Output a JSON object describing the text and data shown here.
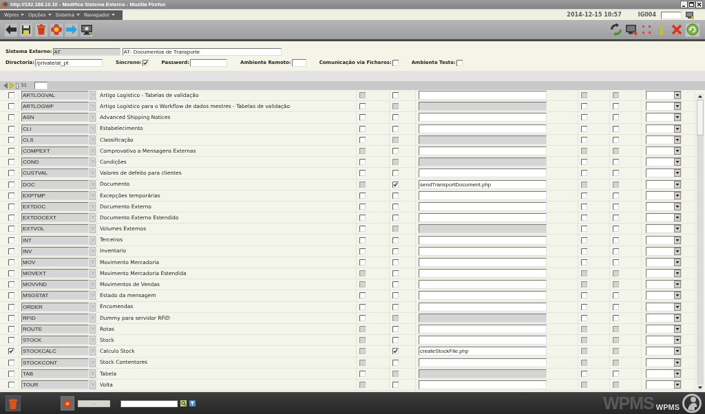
{
  "window": {
    "title": "http://192.168.10.10 - Modifica Sistema Externo - Mozilla Firefox"
  },
  "menu": [
    {
      "label": "Wpms"
    },
    {
      "label": "Opções"
    },
    {
      "label": "Sistema"
    },
    {
      "label": "Navegador"
    }
  ],
  "session": {
    "datetime": "2014-12-15 10:57",
    "user": "IG004"
  },
  "form": {
    "system": {
      "label": "Sistema Externo:",
      "code": {
        "value": "AT",
        "disabled": true
      },
      "name": {
        "value": "AT- Documentos de Transporte",
        "disabled": false
      }
    },
    "directory": {
      "label": "Directoria:",
      "value": "/private/at_pt"
    },
    "synchronous": {
      "label": "Síncrono:",
      "checked": true
    },
    "password": {
      "label": "Password:"
    },
    "remote_environment": {
      "label": "Ambiente Remoto:"
    },
    "file_communication": {
      "label": "Comunicação via Ficheros:",
      "checked": false
    },
    "test_environment": {
      "label": "Ambiente Teste:",
      "checked": false
    }
  },
  "pager": {
    "count": "31"
  },
  "rows": [
    {
      "checked": false,
      "code": "ARTLOGVAL",
      "lookup": "?",
      "description": "Artigo Logistico - Tabelas de validação",
      "flags_left": [
        {
          "checked": false,
          "disabled": true
        },
        {
          "checked": false,
          "disabled": false
        }
      ],
      "script": {
        "disabled": false
      },
      "flags_right": [
        {
          "checked": false,
          "disabled": true
        },
        {
          "checked": false,
          "disabled": true
        }
      ]
    },
    {
      "checked": false,
      "code": "ARTLOGWF",
      "lookup": "?",
      "description": "Artigo Logistico para o Workflow de dados mestres - Tabelas de validação",
      "flags_left": [
        {
          "checked": false,
          "disabled": false
        },
        {
          "checked": false,
          "disabled": true
        }
      ],
      "script": {
        "disabled": true
      },
      "flags_right": [
        {
          "checked": false,
          "disabled": false
        },
        {
          "checked": false,
          "disabled": false
        }
      ]
    },
    {
      "checked": false,
      "code": "ASN",
      "lookup": "?",
      "description": "Advanced Shipping Notices",
      "flags_left": [
        {
          "checked": false,
          "disabled": false
        },
        {
          "checked": false,
          "disabled": false
        }
      ],
      "script": {
        "disabled": false
      },
      "flags_right": [
        {
          "checked": false,
          "disabled": false
        },
        {
          "checked": false,
          "disabled": false
        }
      ]
    },
    {
      "checked": false,
      "code": "CLI",
      "lookup": "?",
      "description": "Estabelecimento",
      "flags_left": [
        {
          "checked": false,
          "disabled": false
        },
        {
          "checked": false,
          "disabled": false
        }
      ],
      "script": {
        "disabled": false
      },
      "flags_right": [
        {
          "checked": false,
          "disabled": false
        },
        {
          "checked": false,
          "disabled": false
        }
      ]
    },
    {
      "checked": false,
      "code": "CLS",
      "lookup": "?",
      "description": "Classificação",
      "flags_left": [
        {
          "checked": false,
          "disabled": false
        },
        {
          "checked": false,
          "disabled": true
        }
      ],
      "script": {
        "disabled": true
      },
      "flags_right": [
        {
          "checked": false,
          "disabled": false
        },
        {
          "checked": false,
          "disabled": false
        }
      ]
    },
    {
      "checked": false,
      "code": "COMPEXT",
      "lookup": "?",
      "description": "Comprovativo a Mensagens Externas",
      "flags_left": [
        {
          "checked": false,
          "disabled": true
        },
        {
          "checked": false,
          "disabled": false
        }
      ],
      "script": {
        "disabled": false
      },
      "flags_right": [
        {
          "checked": false,
          "disabled": true
        },
        {
          "checked": false,
          "disabled": true
        }
      ]
    },
    {
      "checked": false,
      "code": "COND",
      "lookup": "?",
      "description": "Condições",
      "flags_left": [
        {
          "checked": false,
          "disabled": false
        },
        {
          "checked": false,
          "disabled": true
        }
      ],
      "script": {
        "disabled": true
      },
      "flags_right": [
        {
          "checked": false,
          "disabled": false
        },
        {
          "checked": false,
          "disabled": false
        }
      ]
    },
    {
      "checked": false,
      "code": "CUSTVAL",
      "lookup": "?",
      "description": "Valores de defeito para clientes",
      "flags_left": [
        {
          "checked": false,
          "disabled": false
        },
        {
          "checked": false,
          "disabled": false
        }
      ],
      "script": {
        "disabled": false
      },
      "flags_right": [
        {
          "checked": false,
          "disabled": false
        },
        {
          "checked": false,
          "disabled": false
        }
      ]
    },
    {
      "checked": false,
      "code": "DOC",
      "lookup": "?",
      "description": "Documento",
      "flags_left": [
        {
          "checked": false,
          "disabled": true
        },
        {
          "checked": true,
          "disabled": false
        }
      ],
      "script": {
        "value": "sendTransportDocument.php",
        "disabled": false
      },
      "flags_right": [
        {
          "checked": false,
          "disabled": true
        },
        {
          "checked": false,
          "disabled": true
        }
      ]
    },
    {
      "checked": false,
      "code": "EXPTMP",
      "lookup": "?",
      "description": "Excepções temporárias",
      "flags_left": [
        {
          "checked": false,
          "disabled": false
        },
        {
          "checked": false,
          "disabled": false
        }
      ],
      "script": {
        "disabled": false
      },
      "flags_right": [
        {
          "checked": false,
          "disabled": false
        },
        {
          "checked": false,
          "disabled": false
        }
      ]
    },
    {
      "checked": false,
      "code": "EXTDOC",
      "lookup": "?",
      "description": "Documento Externo",
      "flags_left": [
        {
          "checked": false,
          "disabled": false
        },
        {
          "checked": false,
          "disabled": false
        }
      ],
      "script": {
        "disabled": false
      },
      "flags_right": [
        {
          "checked": false,
          "disabled": false
        },
        {
          "checked": false,
          "disabled": false
        }
      ]
    },
    {
      "checked": false,
      "code": "EXTDOCEXT",
      "lookup": "?",
      "description": "Documento Externo Estendido",
      "flags_left": [
        {
          "checked": false,
          "disabled": false
        },
        {
          "checked": false,
          "disabled": false
        }
      ],
      "script": {
        "disabled": false
      },
      "flags_right": [
        {
          "checked": false,
          "disabled": false
        },
        {
          "checked": false,
          "disabled": false
        }
      ]
    },
    {
      "checked": false,
      "code": "EXTVOL",
      "lookup": "?",
      "description": "Volumes Externos",
      "flags_left": [
        {
          "checked": false,
          "disabled": false
        },
        {
          "checked": false,
          "disabled": true
        }
      ],
      "script": {
        "disabled": true
      },
      "flags_right": [
        {
          "checked": false,
          "disabled": false
        },
        {
          "checked": false,
          "disabled": false
        }
      ]
    },
    {
      "checked": false,
      "code": "INT",
      "lookup": "?",
      "description": "Terceiros",
      "flags_left": [
        {
          "checked": false,
          "disabled": false
        },
        {
          "checked": false,
          "disabled": false
        }
      ],
      "script": {
        "disabled": false
      },
      "flags_right": [
        {
          "checked": false,
          "disabled": false
        },
        {
          "checked": false,
          "disabled": false
        }
      ]
    },
    {
      "checked": false,
      "code": "INV",
      "lookup": "?",
      "description": "Inventario",
      "flags_left": [
        {
          "checked": false,
          "disabled": false
        },
        {
          "checked": false,
          "disabled": false
        }
      ],
      "script": {
        "disabled": false
      },
      "flags_right": [
        {
          "checked": false,
          "disabled": false
        },
        {
          "checked": false,
          "disabled": false
        }
      ]
    },
    {
      "checked": false,
      "code": "MOV",
      "lookup": "?",
      "description": "Movimento Mercadoria",
      "flags_left": [
        {
          "checked": false,
          "disabled": false
        },
        {
          "checked": false,
          "disabled": false
        }
      ],
      "script": {
        "disabled": false
      },
      "flags_right": [
        {
          "checked": false,
          "disabled": false
        },
        {
          "checked": false,
          "disabled": false
        }
      ]
    },
    {
      "checked": false,
      "code": "MOVEXT",
      "lookup": "?",
      "description": "Movimento Mercadoria Estendida",
      "flags_left": [
        {
          "checked": false,
          "disabled": true
        },
        {
          "checked": false,
          "disabled": false
        }
      ],
      "script": {
        "disabled": false
      },
      "flags_right": [
        {
          "checked": false,
          "disabled": true
        },
        {
          "checked": false,
          "disabled": true
        }
      ]
    },
    {
      "checked": false,
      "code": "MOVVND",
      "lookup": "?",
      "description": "Movimentos de Vendas",
      "flags_left": [
        {
          "checked": false,
          "disabled": true
        },
        {
          "checked": false,
          "disabled": false
        }
      ],
      "script": {
        "disabled": false
      },
      "flags_right": [
        {
          "checked": false,
          "disabled": true
        },
        {
          "checked": false,
          "disabled": true
        }
      ]
    },
    {
      "checked": false,
      "code": "MSGSTAT",
      "lookup": "?",
      "description": "Estado da mensagem",
      "flags_left": [
        {
          "checked": false,
          "disabled": false
        },
        {
          "checked": false,
          "disabled": false
        }
      ],
      "script": {
        "disabled": false
      },
      "flags_right": [
        {
          "checked": false,
          "disabled": false
        },
        {
          "checked": false,
          "disabled": false
        }
      ]
    },
    {
      "checked": false,
      "code": "ORDER",
      "lookup": "?",
      "description": "Encomendas",
      "flags_left": [
        {
          "checked": false,
          "disabled": false
        },
        {
          "checked": false,
          "disabled": false
        }
      ],
      "script": {
        "disabled": false
      },
      "flags_right": [
        {
          "checked": false,
          "disabled": false
        },
        {
          "checked": false,
          "disabled": false
        }
      ]
    },
    {
      "checked": false,
      "code": "RFID",
      "lookup": "?",
      "description": "Dummy para servidor RFID",
      "flags_left": [
        {
          "checked": false,
          "disabled": false
        },
        {
          "checked": false,
          "disabled": true
        }
      ],
      "script": {
        "disabled": true
      },
      "flags_right": [
        {
          "checked": false,
          "disabled": false
        },
        {
          "checked": false,
          "disabled": false
        }
      ]
    },
    {
      "checked": false,
      "code": "ROUTE",
      "lookup": "?",
      "description": "Rotas",
      "flags_left": [
        {
          "checked": false,
          "disabled": true
        },
        {
          "checked": false,
          "disabled": false
        }
      ],
      "script": {
        "disabled": false
      },
      "flags_right": [
        {
          "checked": false,
          "disabled": true
        },
        {
          "checked": false,
          "disabled": true
        }
      ]
    },
    {
      "checked": false,
      "code": "STOCK",
      "lookup": "?",
      "description": "Stock",
      "flags_left": [
        {
          "checked": false,
          "disabled": true
        },
        {
          "checked": false,
          "disabled": false
        }
      ],
      "script": {
        "disabled": false
      },
      "flags_right": [
        {
          "checked": false,
          "disabled": true
        },
        {
          "checked": false,
          "disabled": true
        }
      ]
    },
    {
      "checked": true,
      "code": "STOCKCALC",
      "lookup": "?",
      "description": "Calculo Stock",
      "flags_left": [
        {
          "checked": false,
          "disabled": true
        },
        {
          "checked": true,
          "disabled": false
        }
      ],
      "script": {
        "value": "createStockFile.php",
        "disabled": false
      },
      "flags_right": [
        {
          "checked": false,
          "disabled": true
        },
        {
          "checked": false,
          "disabled": true
        }
      ]
    },
    {
      "checked": false,
      "code": "STOCKCONT",
      "lookup": "?",
      "description": "Stock Contentores",
      "flags_left": [
        {
          "checked": false,
          "disabled": true
        },
        {
          "checked": false,
          "disabled": false
        }
      ],
      "script": {
        "disabled": false
      },
      "flags_right": [
        {
          "checked": false,
          "disabled": true
        },
        {
          "checked": false,
          "disabled": true
        }
      ]
    },
    {
      "checked": false,
      "code": "TAB",
      "lookup": "?",
      "description": "Tabela",
      "flags_left": [
        {
          "checked": false,
          "disabled": false
        },
        {
          "checked": false,
          "disabled": true
        }
      ],
      "script": {
        "disabled": true
      },
      "flags_right": [
        {
          "checked": false,
          "disabled": false
        },
        {
          "checked": false,
          "disabled": false
        }
      ]
    },
    {
      "checked": false,
      "code": "TOUR",
      "lookup": "?",
      "description": "Volta",
      "flags_left": [
        {
          "checked": false,
          "disabled": true
        },
        {
          "checked": false,
          "disabled": false
        }
      ],
      "script": {
        "disabled": false
      },
      "flags_right": [
        {
          "checked": false,
          "disabled": true
        },
        {
          "checked": false,
          "disabled": true
        }
      ]
    }
  ],
  "footer": {
    "more_button": "...",
    "logo_backdrop": "WPMS",
    "logo": "WPMS"
  }
}
